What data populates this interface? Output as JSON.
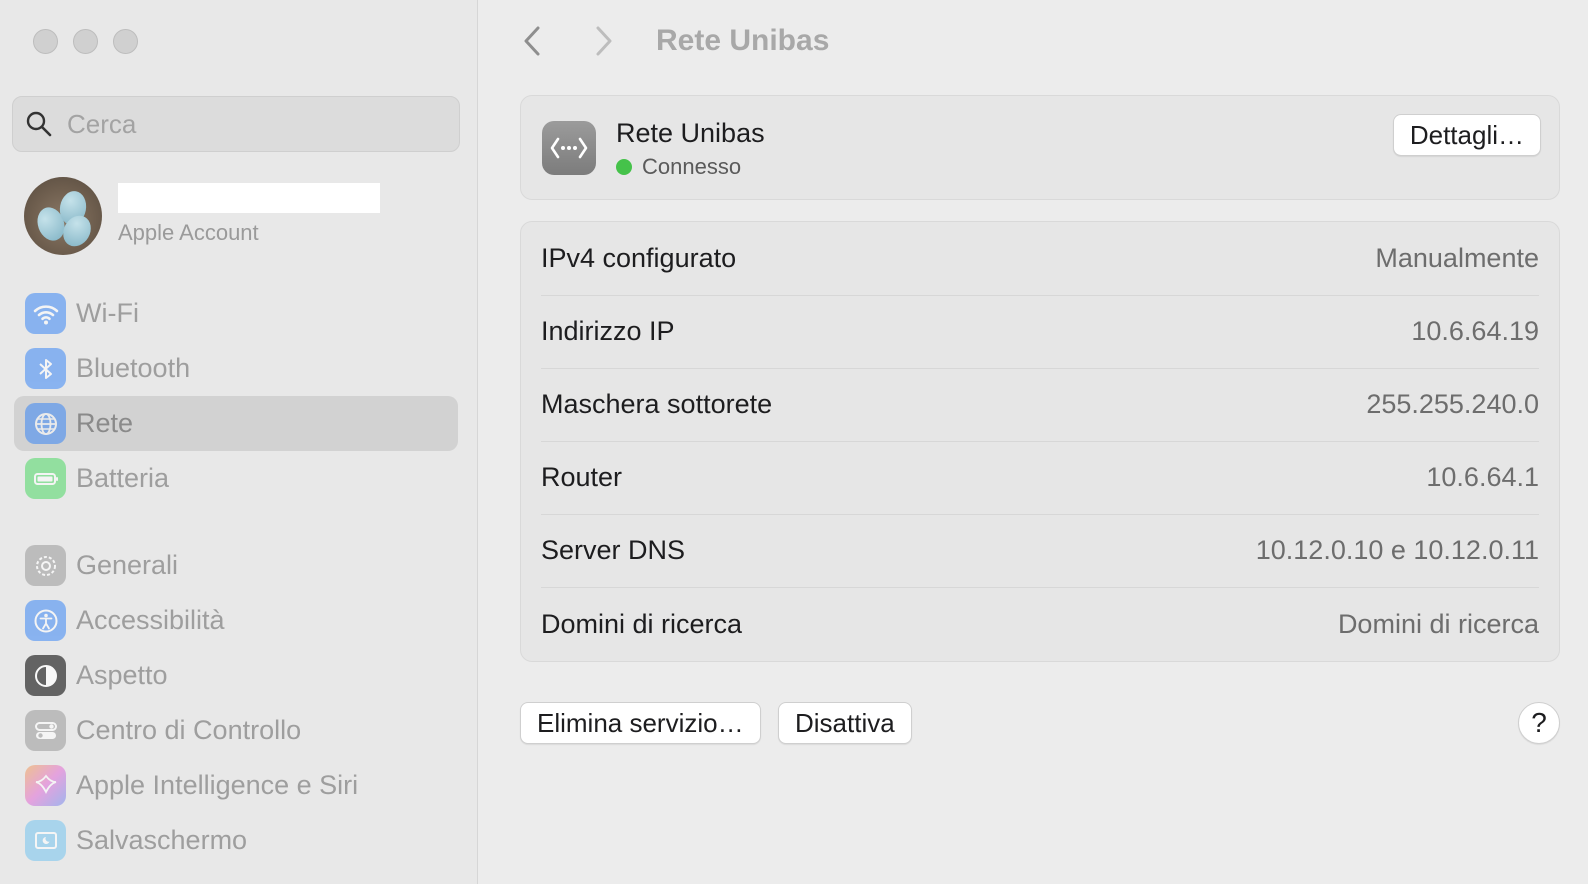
{
  "sidebar": {
    "search": {
      "placeholder": "Cerca"
    },
    "account": {
      "label": "Apple Account"
    },
    "items": [
      {
        "label": "Wi-Fi",
        "icon": "wifi-icon",
        "color": "#3a87f5"
      },
      {
        "label": "Bluetooth",
        "icon": "bluetooth-icon",
        "color": "#3a87f5"
      },
      {
        "label": "Rete",
        "icon": "globe-icon",
        "color": "#3a87f5",
        "selected": true
      },
      {
        "label": "Batteria",
        "icon": "battery-icon",
        "color": "#4cd964"
      },
      {
        "label": "Generali",
        "icon": "gear-icon",
        "color": "#a0a0a0"
      },
      {
        "label": "Accessibilità",
        "icon": "accessibility-icon",
        "color": "#3a87f5"
      },
      {
        "label": "Aspetto",
        "icon": "appearance-icon",
        "color": "#2b2b2b"
      },
      {
        "label": "Centro di Controllo",
        "icon": "control-center-icon",
        "color": "#a0a0a0"
      },
      {
        "label": "Apple Intelligence e Siri",
        "icon": "siri-icon",
        "color": "#e26ad6"
      },
      {
        "label": "Salvaschermo",
        "icon": "screensaver-icon",
        "color": "#7ec7f0"
      }
    ]
  },
  "main": {
    "title": "Rete Unibas",
    "network": {
      "name": "Rete Unibas",
      "status": "Connesso",
      "status_color": "#45c24a",
      "details_label": "Dettagli…"
    },
    "rows": [
      {
        "label": "IPv4 configurato",
        "value": "Manualmente"
      },
      {
        "label": "Indirizzo IP",
        "value": "10.6.64.19"
      },
      {
        "label": "Maschera sottorete",
        "value": "255.255.240.0"
      },
      {
        "label": "Router",
        "value": "10.6.64.1"
      },
      {
        "label": "Server DNS",
        "value": "10.12.0.10 e 10.12.0.11"
      },
      {
        "label": "Domini di ricerca",
        "value": "Domini di ricerca"
      }
    ],
    "buttons": {
      "delete": "Elimina servizio…",
      "disable": "Disattiva",
      "help": "?"
    }
  }
}
